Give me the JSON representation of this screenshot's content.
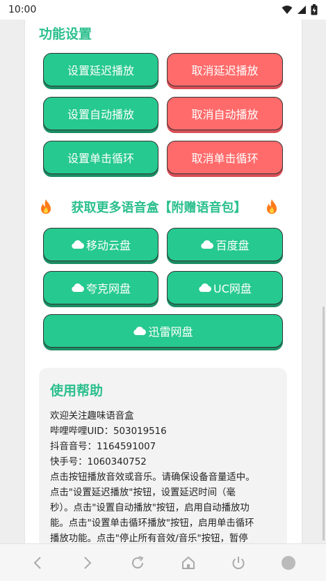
{
  "status": {
    "time": "10:00"
  },
  "settings": {
    "title": "功能设置",
    "buttons": [
      {
        "label": "设置延迟播放",
        "color": "#26c990"
      },
      {
        "label": "取消延迟播放",
        "color": "#ff6b6b"
      },
      {
        "label": "设置自动播放",
        "color": "#26c990"
      },
      {
        "label": "取消自动播放",
        "color": "#ff6b6b"
      },
      {
        "label": "设置单击循环",
        "color": "#26c990"
      },
      {
        "label": "取消单击循环",
        "color": "#ff6b6b"
      }
    ]
  },
  "promo": {
    "text": "获取更多语音盒【附赠语音包】",
    "icon": "fire-icon"
  },
  "downloads": {
    "icon": "cloud-icon",
    "buttons": [
      {
        "label": "移动云盘"
      },
      {
        "label": "百度盘"
      },
      {
        "label": "夸克网盘"
      },
      {
        "label": "UC网盘"
      },
      {
        "label": "迅雷网盘"
      }
    ]
  },
  "help": {
    "title": "使用帮助",
    "lines": [
      "欢迎关注趣味语音盒",
      "哔哩哔哩UID：503019516",
      "抖音音号：1164591007",
      "快手号：1060340752",
      "点击按钮播放音效或音乐。请确保设备音量适中。",
      "点击\"设置延迟播放\"按钮，设置延迟时间（毫",
      "秒）。点击\"设置自动播放\"按钮，启用自动播放功",
      "能。点击\"设置单击循环播放\"按钮，启用单击循环",
      "播放功能。点击\"停止所有音效/音乐\"按钮，暂停"
    ]
  },
  "colors": {
    "accent": "#2bbf8e",
    "green_button": "#26c990",
    "red_button": "#ff6b6b"
  },
  "nav": {
    "icons": [
      "back-icon",
      "forward-icon",
      "refresh-icon",
      "home-icon",
      "power-icon",
      "menu-circle-icon"
    ]
  }
}
